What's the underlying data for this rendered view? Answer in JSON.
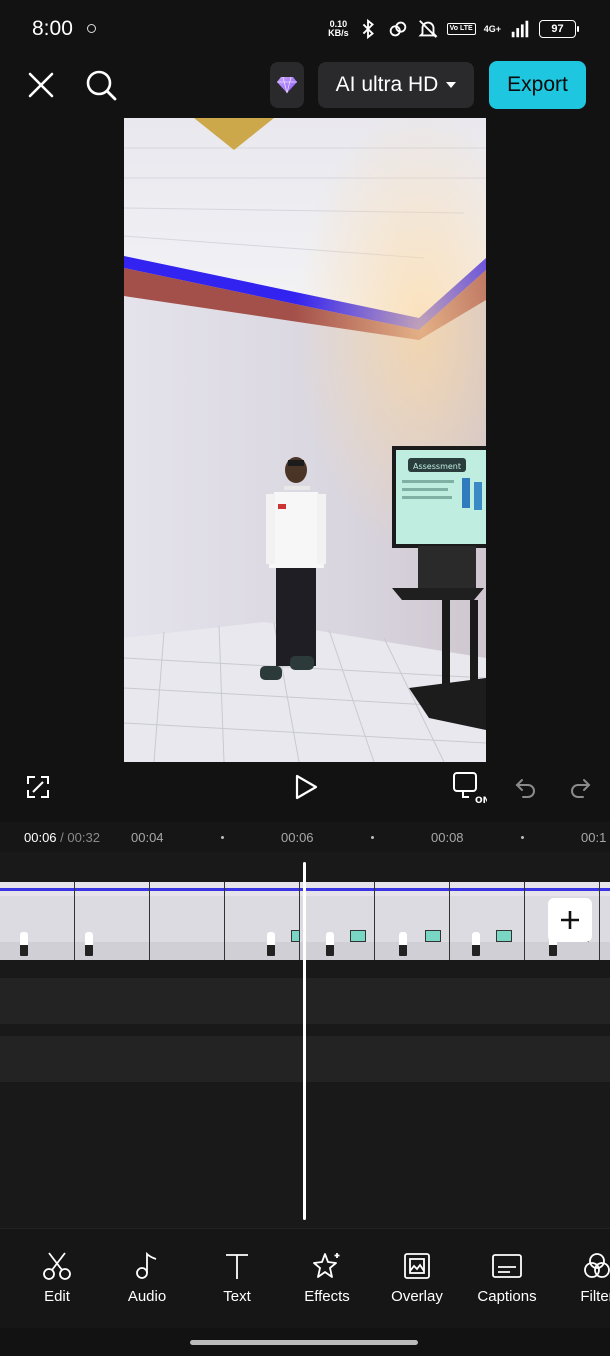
{
  "status_bar": {
    "time": "8:00",
    "net_speed_value": "0.10",
    "net_speed_unit": "KB/s",
    "volte": "Vo LTE",
    "network_type": "4G+",
    "battery": "97"
  },
  "top_bar": {
    "quality_label": "AI ultra HD",
    "export_label": "Export",
    "accent_color": "#1ec6e0"
  },
  "preview": {
    "slide_title": "Assessment"
  },
  "controls": {
    "captions_toggle_label": "ON"
  },
  "timeline": {
    "current_time": "00:06",
    "total_time": "00:32",
    "ticks": [
      "00:04",
      "00:06",
      "00:08",
      "00:1"
    ]
  },
  "tools": [
    {
      "label": "Edit",
      "icon": "scissors-icon"
    },
    {
      "label": "Audio",
      "icon": "music-note-icon"
    },
    {
      "label": "Text",
      "icon": "text-icon"
    },
    {
      "label": "Effects",
      "icon": "star-sparkle-icon"
    },
    {
      "label": "Overlay",
      "icon": "overlay-image-icon"
    },
    {
      "label": "Captions",
      "icon": "captions-icon"
    },
    {
      "label": "Filter",
      "icon": "filter-icon"
    }
  ]
}
